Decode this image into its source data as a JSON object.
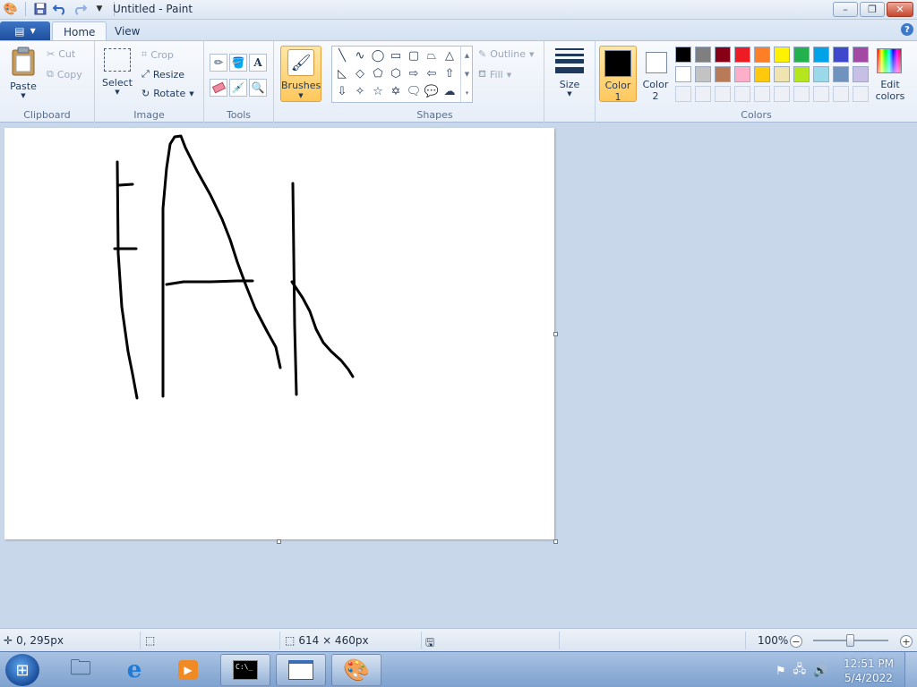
{
  "window": {
    "title": "Untitled - Paint"
  },
  "tabs": [
    {
      "label": "Home"
    },
    {
      "label": "View"
    }
  ],
  "ribbon": {
    "clipboard": {
      "label": "Clipboard",
      "paste": "Paste",
      "cut": "Cut",
      "copy": "Copy"
    },
    "image": {
      "label": "Image",
      "select": "Select",
      "crop": "Crop",
      "resize": "Resize",
      "rotate": "Rotate"
    },
    "tools": {
      "label": "Tools"
    },
    "brushes": {
      "label": "Brushes"
    },
    "shapes": {
      "label": "Shapes",
      "outline": "Outline",
      "fill": "Fill",
      "size": "Size"
    },
    "colors": {
      "label": "Colors",
      "color1_line1": "Color",
      "color1_line2": "1",
      "color2_line1": "Color",
      "color2_line2": "2",
      "edit_line1": "Edit",
      "edit_line2": "colors",
      "color1_value": "#000000",
      "color2_value": "#ffffff",
      "palette_row1": [
        "#000000",
        "#7f7f7f",
        "#880015",
        "#ed1c24",
        "#ff7f27",
        "#fff200",
        "#22b14c",
        "#00a2e8",
        "#3f48cc",
        "#a349a4"
      ],
      "palette_row2": [
        "#ffffff",
        "#c3c3c3",
        "#b97a57",
        "#ffaec9",
        "#ffc90e",
        "#efe4b0",
        "#b5e61d",
        "#99d9ea",
        "#7092be",
        "#c8bfe7"
      ]
    }
  },
  "status": {
    "cursor_pos": "0, 295px",
    "canvas_size": "614 × 460px",
    "zoom": "100%",
    "zoom_fraction": 0.5
  },
  "taskbar": {
    "time": "12:51 PM",
    "date": "5/4/2022"
  }
}
